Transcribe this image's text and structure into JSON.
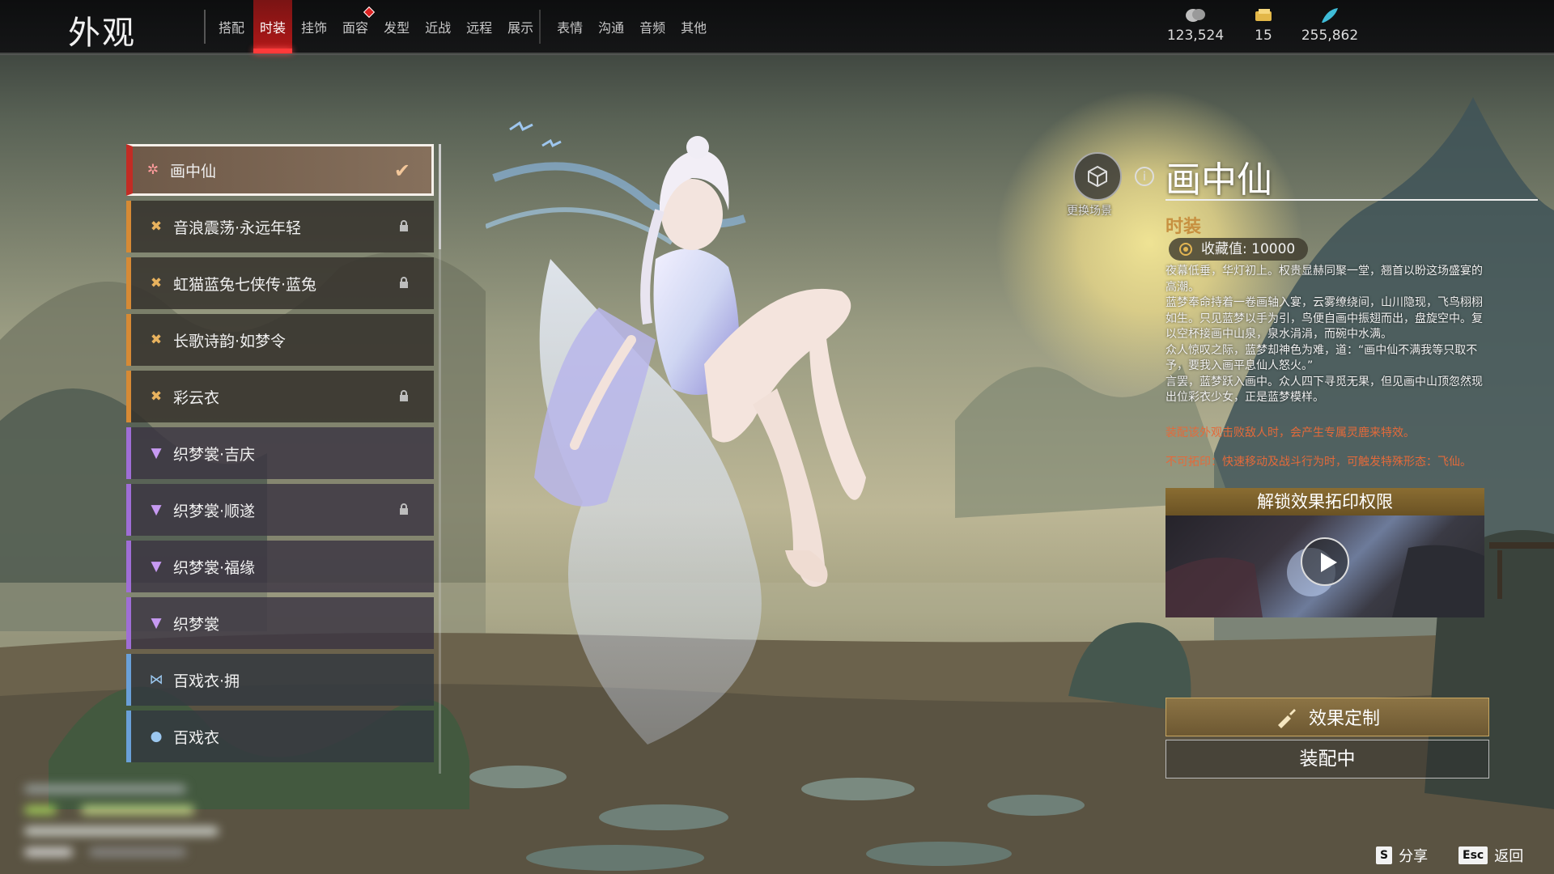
{
  "header": {
    "title": "外观",
    "tabs": [
      {
        "label": "搭配",
        "active": false,
        "notify": false
      },
      {
        "label": "时装",
        "active": true,
        "notify": false
      },
      {
        "label": "挂饰",
        "active": false,
        "notify": false
      },
      {
        "label": "面容",
        "active": false,
        "notify": true
      },
      {
        "label": "发型",
        "active": false,
        "notify": false
      },
      {
        "label": "近战",
        "active": false,
        "notify": false
      },
      {
        "label": "远程",
        "active": false,
        "notify": false
      },
      {
        "label": "展示",
        "active": false,
        "notify": false
      },
      {
        "label": "表情",
        "active": false,
        "notify": false,
        "group_start": true
      },
      {
        "label": "沟通",
        "active": false,
        "notify": false
      },
      {
        "label": "音频",
        "active": false,
        "notify": false
      },
      {
        "label": "其他",
        "active": false,
        "notify": false
      }
    ],
    "currencies": [
      {
        "icon": "coin-icon",
        "value": "123,524"
      },
      {
        "icon": "ticket-icon",
        "value": "15"
      },
      {
        "icon": "feather-icon",
        "value": "255,862"
      }
    ]
  },
  "outfits": [
    {
      "name": "画中仙",
      "rarity": "red",
      "icon": "star-icon",
      "selected": true,
      "locked": false
    },
    {
      "name": "音浪震荡·永远年轻",
      "rarity": "orange",
      "icon": "burst-icon",
      "selected": false,
      "locked": true
    },
    {
      "name": "虹猫蓝兔七侠传·蓝兔",
      "rarity": "orange",
      "icon": "burst-icon",
      "selected": false,
      "locked": true
    },
    {
      "name": "长歌诗韵·如梦令",
      "rarity": "orange",
      "icon": "burst-icon",
      "selected": false,
      "locked": false
    },
    {
      "name": "彩云衣",
      "rarity": "orange",
      "icon": "burst-icon",
      "selected": false,
      "locked": true
    },
    {
      "name": "织梦裳·吉庆",
      "rarity": "purple",
      "icon": "wings-icon",
      "selected": false,
      "locked": false
    },
    {
      "name": "织梦裳·顺遂",
      "rarity": "purple",
      "icon": "wings-icon",
      "selected": false,
      "locked": true
    },
    {
      "name": "织梦裳·福缘",
      "rarity": "purple",
      "icon": "wings-icon",
      "selected": false,
      "locked": false
    },
    {
      "name": "织梦裳",
      "rarity": "purple",
      "icon": "wings-icon",
      "selected": false,
      "locked": false
    },
    {
      "name": "百戏衣·拥",
      "rarity": "blue",
      "icon": "butterfly-icon",
      "selected": false,
      "locked": false
    },
    {
      "name": "百戏衣",
      "rarity": "blue",
      "icon": "drop-icon",
      "selected": false,
      "locked": false
    }
  ],
  "detail": {
    "scene_button_label": "更换场景",
    "title": "画中仙",
    "category": "时装",
    "collection": "收藏值: 10000",
    "description": [
      "夜幕低垂，华灯初上。权贵显赫同聚一堂，翘首以盼这场盛宴的高潮。",
      "蓝梦奉命持着一卷画轴入宴，云雾缭绕间，山川隐现，飞鸟栩栩如生。只见蓝梦以手为引，鸟便自画中振翅而出，盘旋空中。复以空杯接画中山泉，泉水涓涓，而碗中水满。",
      "众人惊叹之际，蓝梦却神色为难，道：“画中仙不满我等只取不予，要我入画平息仙人怒火。”",
      "言罢，蓝梦跃入画中。众人四下寻觅无果，但见画中山顶忽然现出位彩衣少女，正是蓝梦模样。"
    ],
    "effect_note": "装配该外观击败敌人时，会产生专属灵鹿来特效。",
    "imprint_note": "不可拓印：快速移动及战斗行为时，可触发特殊形态：飞仙。",
    "unlock_header": "解锁效果拓印权限",
    "custom_button": "效果定制",
    "equip_button": "装配中"
  },
  "footer": {
    "share_key": "S",
    "share_label": "分享",
    "back_key": "Esc",
    "back_label": "返回"
  }
}
